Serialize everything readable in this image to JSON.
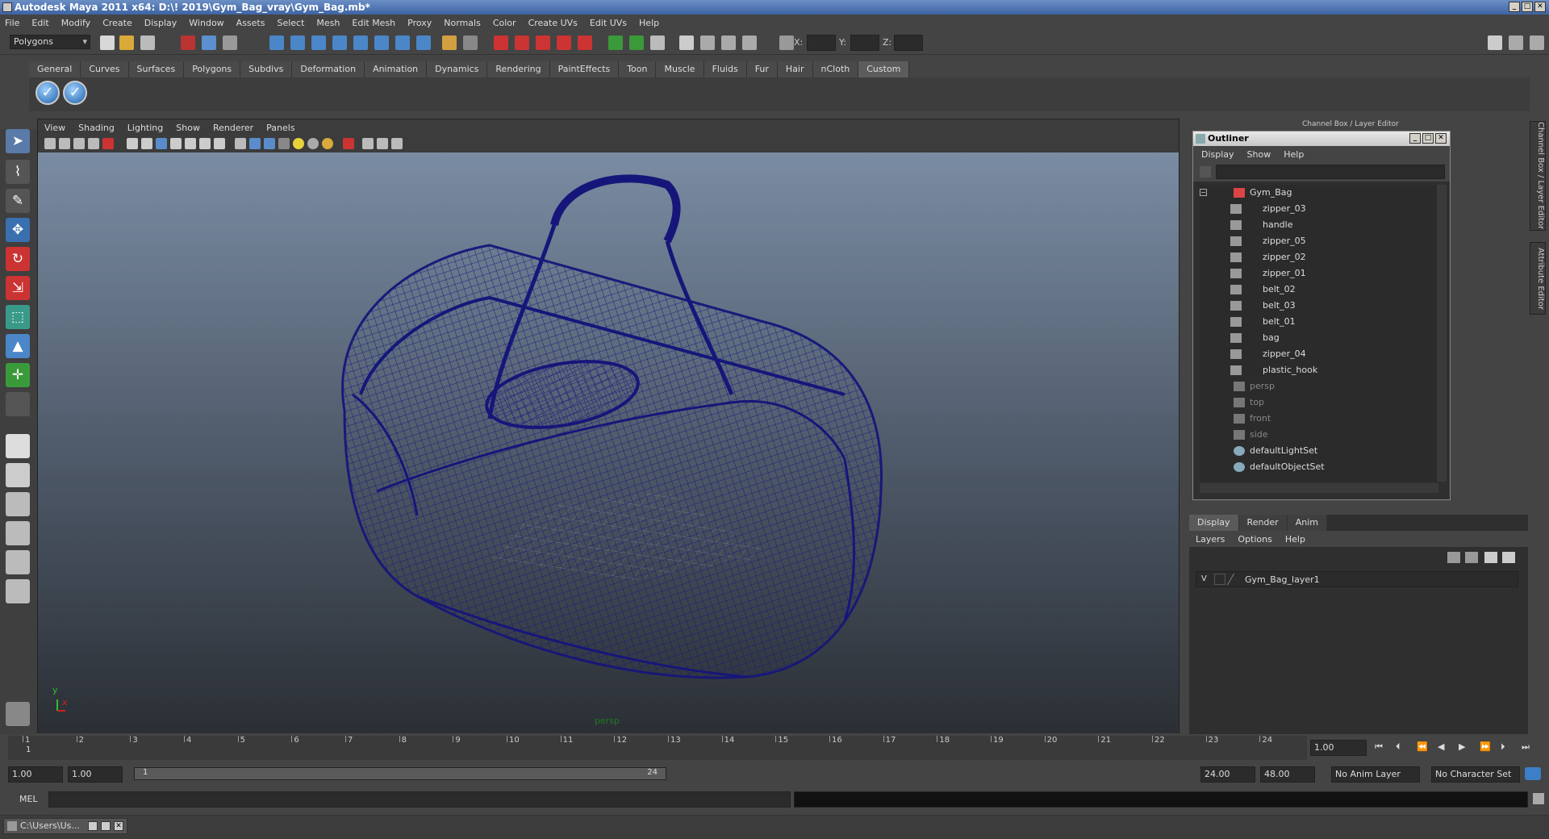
{
  "window": {
    "title": "Autodesk Maya 2011 x64: D:\\! 2019\\Gym_Bag_vray\\Gym_Bag.mb*"
  },
  "menus": [
    "File",
    "Edit",
    "Modify",
    "Create",
    "Display",
    "Window",
    "Assets",
    "Select",
    "Mesh",
    "Edit Mesh",
    "Proxy",
    "Normals",
    "Color",
    "Create UVs",
    "Edit UVs",
    "Help"
  ],
  "statusline": {
    "mode": "Polygons",
    "x_label": "X:",
    "y_label": "Y:",
    "z_label": "Z:"
  },
  "shelf": {
    "tabs": [
      "General",
      "Curves",
      "Surfaces",
      "Polygons",
      "Subdivs",
      "Deformation",
      "Animation",
      "Dynamics",
      "Rendering",
      "PaintEffects",
      "Toon",
      "Muscle",
      "Fluids",
      "Fur",
      "Hair",
      "nCloth",
      "Custom"
    ],
    "active": "Custom"
  },
  "viewport": {
    "menu": [
      "View",
      "Shading",
      "Lighting",
      "Show",
      "Renderer",
      "Panels"
    ],
    "camera_label": "persp",
    "axis_y": "y",
    "axis_x": "x"
  },
  "outliner": {
    "title": "Outliner",
    "menu": [
      "Display",
      "Show",
      "Help"
    ],
    "items": [
      {
        "label": "Gym_Bag",
        "kind": "group",
        "dim": false
      },
      {
        "label": "zipper_03",
        "kind": "mesh",
        "dim": false
      },
      {
        "label": "handle",
        "kind": "mesh",
        "dim": false
      },
      {
        "label": "zipper_05",
        "kind": "mesh",
        "dim": false
      },
      {
        "label": "zipper_02",
        "kind": "mesh",
        "dim": false
      },
      {
        "label": "zipper_01",
        "kind": "mesh",
        "dim": false
      },
      {
        "label": "belt_02",
        "kind": "mesh",
        "dim": false
      },
      {
        "label": "belt_03",
        "kind": "mesh",
        "dim": false
      },
      {
        "label": "belt_01",
        "kind": "mesh",
        "dim": false
      },
      {
        "label": "bag",
        "kind": "mesh",
        "dim": false
      },
      {
        "label": "zipper_04",
        "kind": "mesh",
        "dim": false
      },
      {
        "label": "plastic_hook",
        "kind": "mesh",
        "dim": false
      },
      {
        "label": "persp",
        "kind": "camera",
        "dim": true
      },
      {
        "label": "top",
        "kind": "camera",
        "dim": true
      },
      {
        "label": "front",
        "kind": "camera",
        "dim": true
      },
      {
        "label": "side",
        "kind": "camera",
        "dim": true
      },
      {
        "label": "defaultLightSet",
        "kind": "set",
        "dim": false
      },
      {
        "label": "defaultObjectSet",
        "kind": "set",
        "dim": false
      }
    ]
  },
  "channel_box_title": "Channel Box / Layer Editor",
  "side_tabs": [
    "Channel Box / Layer Editor",
    "Attribute Editor"
  ],
  "layer_editor": {
    "tabs": [
      "Display",
      "Render",
      "Anim"
    ],
    "active_tab": "Display",
    "menu": [
      "Layers",
      "Options",
      "Help"
    ],
    "layer": {
      "visible": "V",
      "name": "Gym_Bag_layer1"
    }
  },
  "timeline": {
    "ticks": [
      "1",
      "2",
      "3",
      "4",
      "5",
      "6",
      "7",
      "8",
      "9",
      "10",
      "11",
      "12",
      "13",
      "14",
      "15",
      "16",
      "17",
      "18",
      "19",
      "20",
      "21",
      "22",
      "23",
      "24"
    ],
    "current_frame": "1.00",
    "current_marker": "1"
  },
  "range": {
    "start": "1.00",
    "playback_start": "1.00",
    "slider_left": "1",
    "slider_right": "24",
    "playback_end": "24.00",
    "end": "48.00",
    "anim_layer": "No Anim Layer",
    "character_set": "No Character Set"
  },
  "command_line": {
    "label": "MEL"
  },
  "taskbar": {
    "label": "C:\\Users\\Us..."
  }
}
